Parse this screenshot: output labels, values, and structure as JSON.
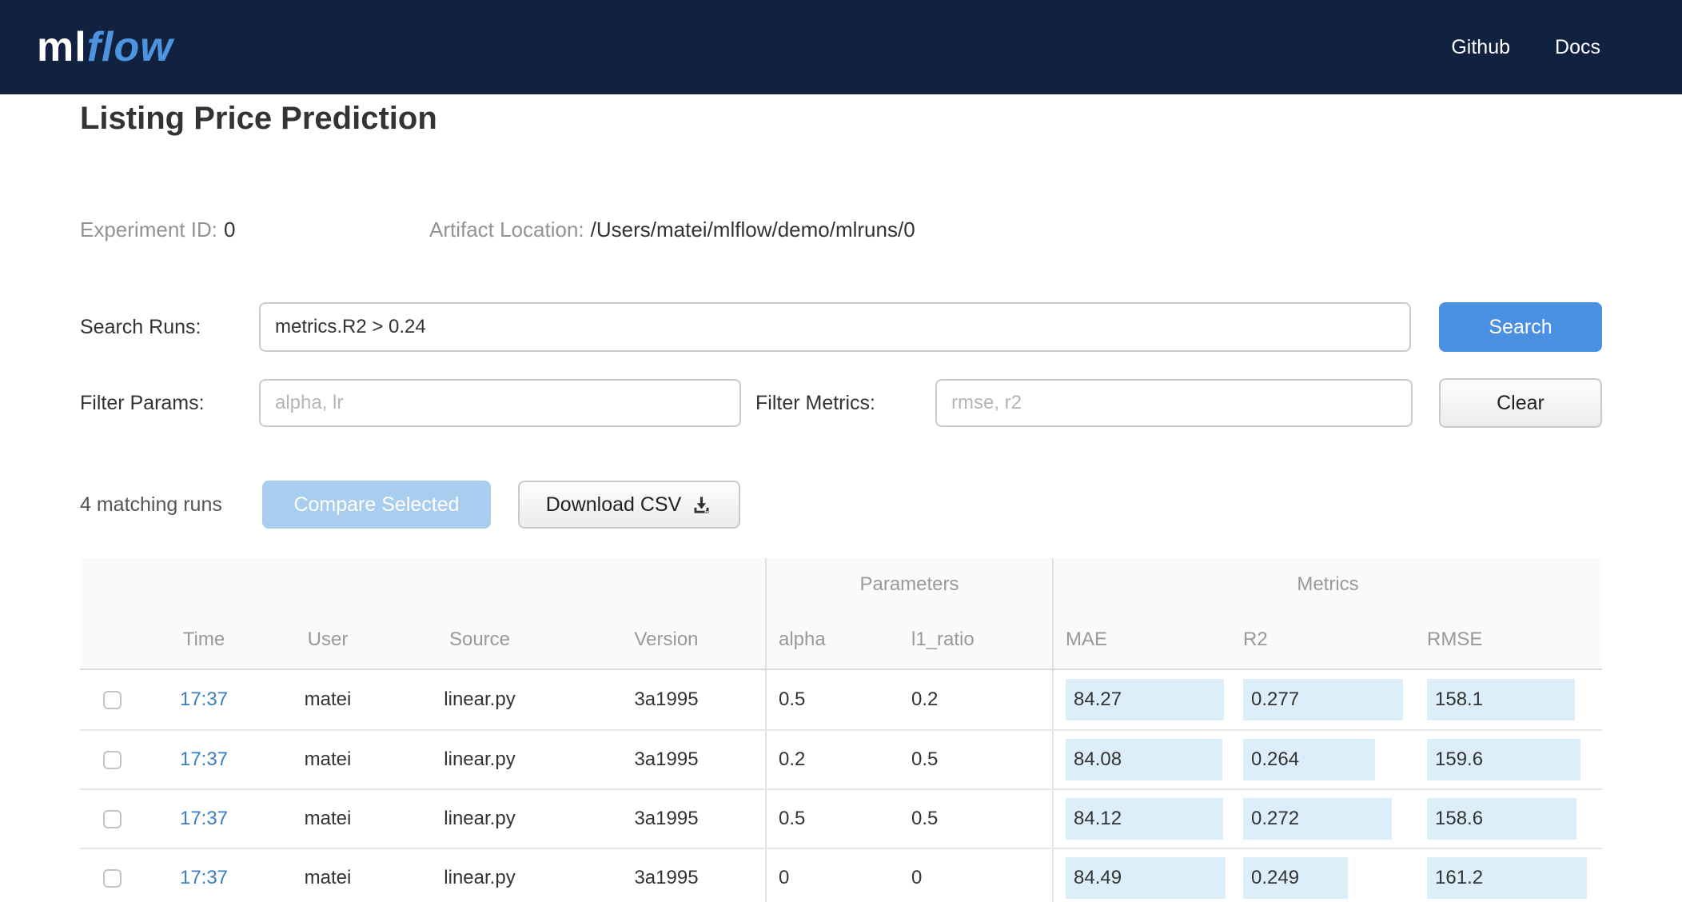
{
  "header": {
    "logo_ml": "ml",
    "logo_flow": "flow",
    "nav": [
      {
        "label": "Github"
      },
      {
        "label": "Docs"
      }
    ]
  },
  "page": {
    "title": "Listing Price Prediction",
    "experiment_id_label": "Experiment ID:",
    "experiment_id": "0",
    "artifact_location_label": "Artifact Location:",
    "artifact_location": "/Users/matei/mlflow/demo/mlruns/0"
  },
  "search": {
    "label": "Search Runs:",
    "value": "metrics.R2 > 0.24",
    "button": "Search"
  },
  "filters": {
    "params_label": "Filter Params:",
    "params_placeholder": "alpha, lr",
    "metrics_label": "Filter Metrics:",
    "metrics_placeholder": "rmse, r2",
    "clear_button": "Clear"
  },
  "actions": {
    "matching_text": "4 matching runs",
    "compare_button": "Compare Selected",
    "download_button": "Download CSV",
    "download_icon": "download-icon"
  },
  "table": {
    "group_headers": {
      "parameters": "Parameters",
      "metrics": "Metrics"
    },
    "columns": [
      "Time",
      "User",
      "Source",
      "Version",
      "alpha",
      "l1_ratio",
      "MAE",
      "R2",
      "RMSE"
    ],
    "rows": [
      {
        "time": "17:37",
        "user": "matei",
        "source": "linear.py",
        "version": "3a1995",
        "alpha": "0.5",
        "l1_ratio": "0.2",
        "mae": "84.27",
        "r2": "0.277",
        "rmse": "158.1"
      },
      {
        "time": "17:37",
        "user": "matei",
        "source": "linear.py",
        "version": "3a1995",
        "alpha": "0.2",
        "l1_ratio": "0.5",
        "mae": "84.08",
        "r2": "0.264",
        "rmse": "159.6"
      },
      {
        "time": "17:37",
        "user": "matei",
        "source": "linear.py",
        "version": "3a1995",
        "alpha": "0.5",
        "l1_ratio": "0.5",
        "mae": "84.12",
        "r2": "0.272",
        "rmse": "158.6"
      },
      {
        "time": "17:37",
        "user": "matei",
        "source": "linear.py",
        "version": "3a1995",
        "alpha": "0",
        "l1_ratio": "0",
        "mae": "84.49",
        "r2": "0.249",
        "rmse": "161.2"
      }
    ]
  },
  "colors": {
    "nav_background": "#112240",
    "accent_blue": "#4a90e2",
    "disabled_button_blue": "#a9cdee",
    "link_blue": "#3c7dc4",
    "metric_bar_blue": "#ddeefb"
  }
}
